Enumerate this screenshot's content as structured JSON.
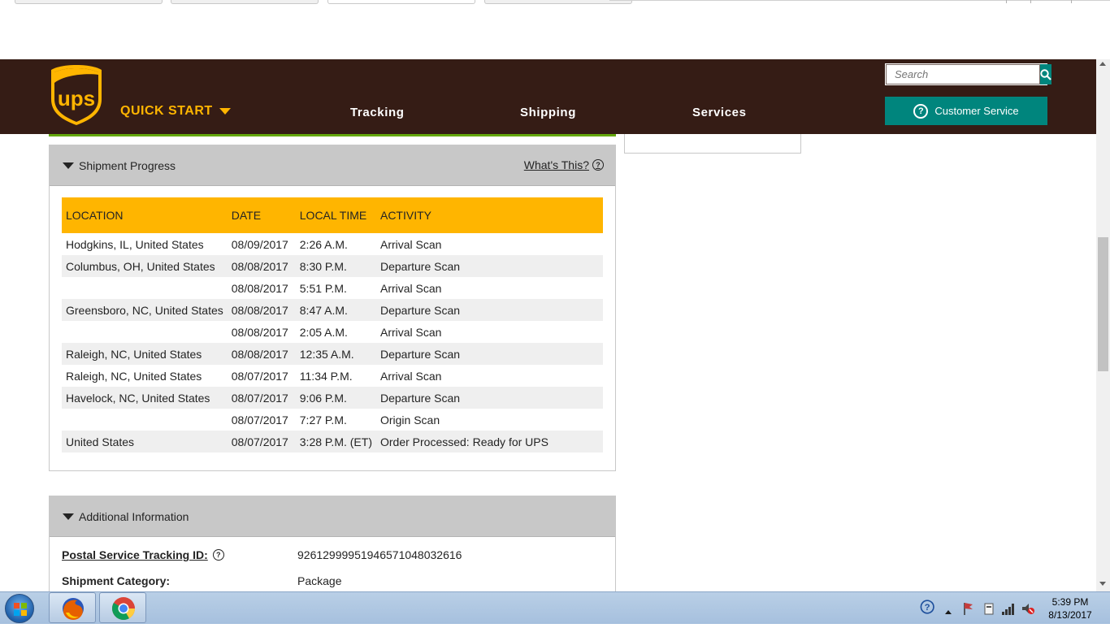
{
  "header": {
    "logo_text": "ups",
    "quick_start": "QUICK START",
    "nav": [
      "Tracking",
      "Shipping",
      "Services"
    ],
    "search_placeholder": "Search",
    "customer_service": "Customer Service"
  },
  "shipment_progress": {
    "title": "Shipment Progress",
    "whats_this": "What's This?",
    "columns": [
      "LOCATION",
      "DATE",
      "LOCAL TIME",
      "ACTIVITY"
    ],
    "rows": [
      {
        "location": "Hodgkins, IL, United States",
        "date": "08/09/2017",
        "time": "2:26 A.M.",
        "activity": "Arrival Scan"
      },
      {
        "location": "Columbus, OH, United States",
        "date": "08/08/2017",
        "time": "8:30 P.M.",
        "activity": "Departure Scan"
      },
      {
        "location": "",
        "date": "08/08/2017",
        "time": "5:51 P.M.",
        "activity": "Arrival Scan"
      },
      {
        "location": "Greensboro, NC, United States",
        "date": "08/08/2017",
        "time": "8:47 A.M.",
        "activity": "Departure Scan"
      },
      {
        "location": "",
        "date": "08/08/2017",
        "time": "2:05 A.M.",
        "activity": "Arrival Scan"
      },
      {
        "location": "Raleigh, NC, United States",
        "date": "08/08/2017",
        "time": "12:35 A.M.",
        "activity": "Departure Scan"
      },
      {
        "location": "Raleigh, NC, United States",
        "date": "08/07/2017",
        "time": "11:34 P.M.",
        "activity": "Arrival Scan"
      },
      {
        "location": "Havelock, NC, United States",
        "date": "08/07/2017",
        "time": "9:06 P.M.",
        "activity": "Departure Scan"
      },
      {
        "location": "",
        "date": "08/07/2017",
        "time": "7:27 P.M.",
        "activity": "Origin Scan"
      },
      {
        "location": "United States",
        "date": "08/07/2017",
        "time": "3:28 P.M. (ET)",
        "activity": "Order Processed: Ready for UPS"
      }
    ]
  },
  "additional_info": {
    "title": "Additional Information",
    "postal_label": "Postal Service Tracking ID:",
    "postal_value": "92612999951946571048032616",
    "category_label": "Shipment Category:",
    "category_value": "Package"
  },
  "taskbar": {
    "time": "5:39 PM",
    "date": "8/13/2017"
  },
  "colors": {
    "ups_brown": "#351c15",
    "ups_gold": "#ffb500",
    "teal": "#00857d",
    "green_line": "#64a70b"
  }
}
